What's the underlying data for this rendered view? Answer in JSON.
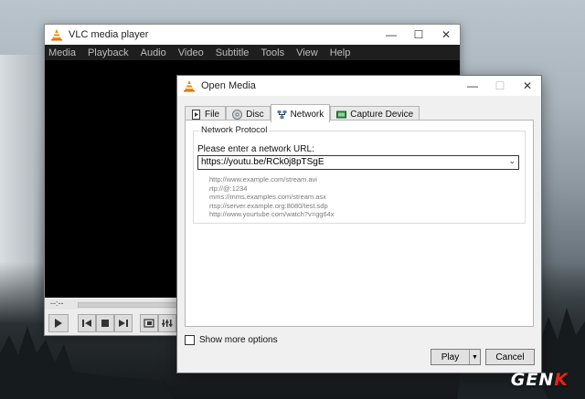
{
  "background": {
    "watermark_left": "GEN",
    "watermark_accent": "K"
  },
  "vlc": {
    "title": "VLC media player",
    "menu": [
      "Media",
      "Playback",
      "Audio",
      "Video",
      "Subtitle",
      "Tools",
      "View",
      "Help"
    ],
    "time": "--:--",
    "icons": [
      "play-icon",
      "previous-icon",
      "stop-icon",
      "next-icon",
      "fullscreen-icon",
      "equalizer-icon"
    ]
  },
  "dialog": {
    "title": "Open Media",
    "tabs": [
      {
        "label": "File",
        "icon": "file-icon"
      },
      {
        "label": "Disc",
        "icon": "disc-icon"
      },
      {
        "label": "Network",
        "icon": "network-icon",
        "active": true
      },
      {
        "label": "Capture Device",
        "icon": "capture-device-icon"
      }
    ],
    "group_title": "Network Protocol",
    "prompt": "Please enter a network URL:",
    "url_value": "https://youtu.be/RCk0j8pTSgE",
    "examples": [
      "http://www.example.com/stream.avi",
      "rtp://@:1234",
      "mms://mms.examples.com/stream.asx",
      "rtsp://server.example.org:8080/test.sdp",
      "http://www.yourtube.com/watch?v=gg64x"
    ],
    "more_options": "Show more options",
    "play": "Play",
    "cancel": "Cancel"
  }
}
